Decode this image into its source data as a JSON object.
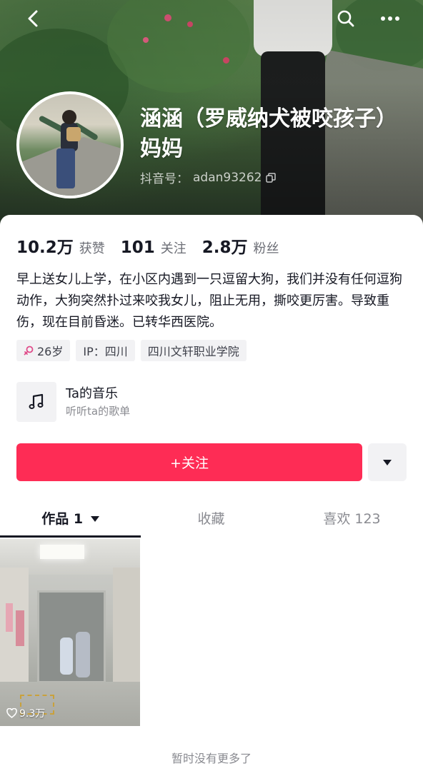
{
  "header": {
    "nickname": "涵涵（罗威纳犬被咬孩子）妈妈",
    "douyin_id_label": "抖音号：",
    "douyin_id": "adan93262",
    "icons": [
      "back-icon",
      "search-icon",
      "more-icon",
      "copy-icon"
    ]
  },
  "stats": {
    "likes_num": "10.2万",
    "likes_label": "获赞",
    "following_num": "101",
    "following_label": "关注",
    "followers_num": "2.8万",
    "followers_label": "粉丝"
  },
  "bio": "早上送女儿上学，在小区内遇到一只逗留大狗，我们并没有任何逗狗动作，大狗突然扑过来咬我女儿，阻止无用，撕咬更厉害。导致重伤，现在目前昏迷。已转华西医院。",
  "tags": [
    {
      "label": "26岁",
      "icon": "female-icon"
    },
    {
      "label": "IP：四川"
    },
    {
      "label": "四川文轩职业学院"
    }
  ],
  "music": {
    "title": "Ta的音乐",
    "subtitle": "听听ta的歌单",
    "icon": "music-note-icon"
  },
  "actions": {
    "follow_label": "+关注"
  },
  "tabs": [
    {
      "label": "作品 1",
      "active": true
    },
    {
      "label": "收藏",
      "active": false
    },
    {
      "label": "喜欢 123",
      "active": false
    }
  ],
  "videos": [
    {
      "likes": "9.3万"
    }
  ],
  "footer": {
    "no_more": "暂时没有更多了"
  },
  "colors": {
    "accent": "#fe2c55",
    "text_primary": "#161823",
    "text_secondary": "#8a8b91",
    "tag_bg": "#f2f2f4"
  }
}
